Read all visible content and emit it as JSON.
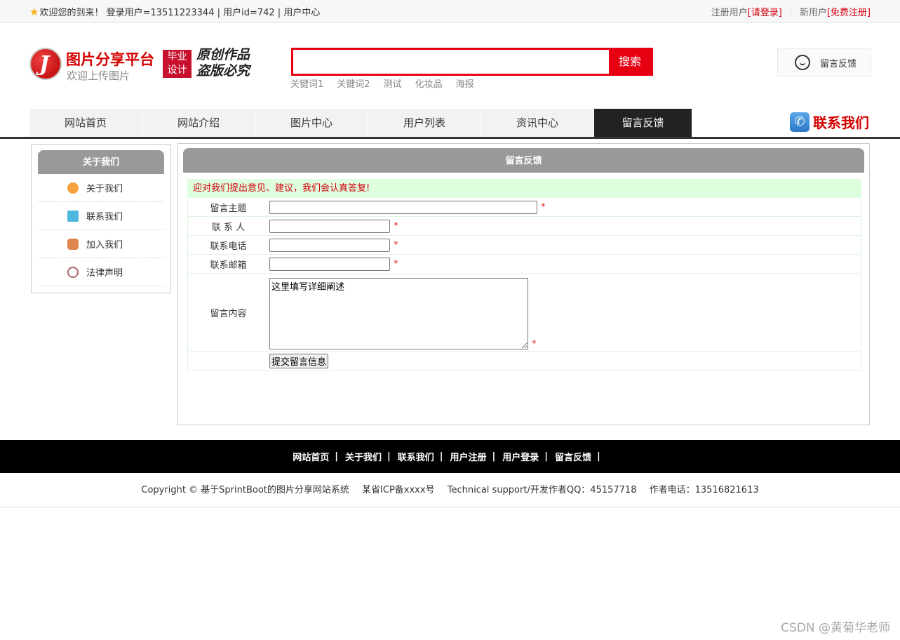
{
  "topbar": {
    "welcome": "欢迎您的到来！ 登录用户=13511223344 | 用户id=742 | 用户中心",
    "register_user": "注册用户",
    "login_link": "[请登录]",
    "new_user": "新用户",
    "free_register": "[免费注册]"
  },
  "header": {
    "logo_title": "图片分享平台",
    "logo_sub": "欢迎上传图片",
    "badge_line1": "毕业",
    "badge_line2": "设计",
    "slogan_line1": "原创作品",
    "slogan_line2": "盗版必究",
    "search_placeholder": "",
    "search_button": "搜索",
    "keywords": [
      "关键词1",
      "关键词2",
      "测试",
      "化妆品",
      "海报"
    ],
    "feedback": "留言反馈"
  },
  "nav": {
    "items": [
      "网站首页",
      "网站介绍",
      "图片中心",
      "用户列表",
      "资讯中心",
      "留言反馈"
    ],
    "contact": "联系我们"
  },
  "sidebar": {
    "title": "关于我们",
    "items": [
      "关于我们",
      "联系我们",
      "加入我们",
      "法律声明"
    ]
  },
  "content": {
    "title": "留言反馈",
    "notice": "迎对我们提出意见、建议，我们会认真答复!",
    "fields": {
      "subject": "留言主题",
      "contact": "联 系 人",
      "phone": "联系电话",
      "email": "联系邮箱",
      "message": "留言内容"
    },
    "message_default": "这里填写详细阐述",
    "required_mark": "*",
    "submit": "提交留言信息"
  },
  "footer": {
    "links": [
      "网站首页",
      "关于我们",
      "联系我们",
      "用户注册",
      "用户登录",
      "留言反馈"
    ],
    "separator": "|",
    "copyright": "Copyright © 基于SprintBoot的图片分享网站系统",
    "icp": "某省ICP备xxxx号",
    "support": "Technical support/开发作者QQ：45157718",
    "phone": "作者电话：13516821613"
  },
  "watermark": "CSDN @黄菊华老师"
}
